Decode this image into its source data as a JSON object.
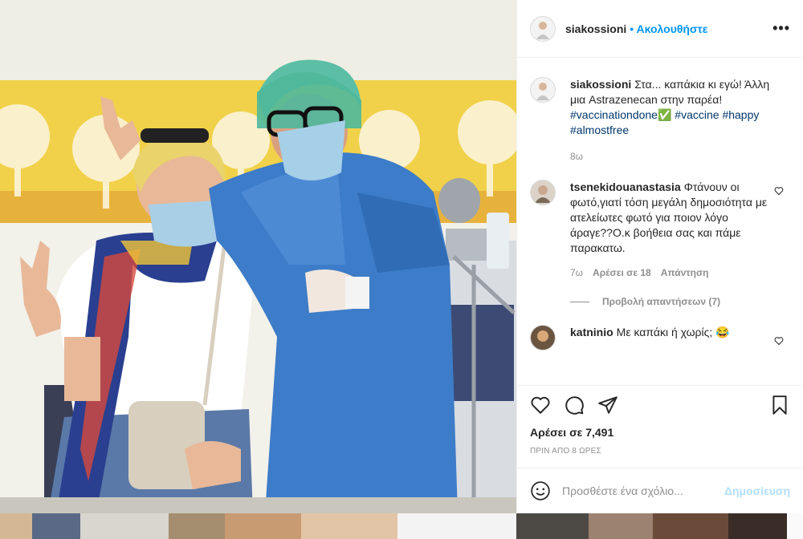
{
  "post": {
    "username": "siakossioni",
    "follow_label": "• Ακολουθήστε",
    "more_label": "•••",
    "caption": {
      "username": "siakossioni",
      "text": "Στα... καπάκια κι εγώ! Άλλη μια Astrazenecan στην παρέα!",
      "hashtags": [
        "#vaccinationdone✅",
        "#vaccine",
        "#happy",
        "#almostfree"
      ],
      "age": "8ω"
    },
    "comments": [
      {
        "username": "tsenekidouanastasia",
        "text": "Φτάνουν οι φωτό,γιατί τόση μεγάλη δημοσιότητα με ατελείωτες φωτό για ποιον λόγο άραγε??Ο.κ βοήθεια σας και πάμε παρακατω.",
        "age": "7ω",
        "likes": "Αρέσει σε 18",
        "reply": "Απάντηση",
        "view_replies": "Προβολή απαντήσεων (7)"
      },
      {
        "username": "katninio",
        "text": "Με καπάκι ή χωρίς; 😂"
      }
    ],
    "likes": "Αρέσει σε 7,491",
    "timestamp": "ΠΡΙΝ ΑΠΟ 8 ΩΡΕΣ",
    "comment_placeholder": "Προσθέστε ένα σχόλιο...",
    "publish_label": "Δημοσίευση"
  },
  "icons": {
    "heart": "heart-icon",
    "comment": "comment-icon",
    "share": "share-icon",
    "save": "bookmark-icon",
    "emoji": "emoji-icon"
  },
  "colors": {
    "accent": "#0095f6",
    "link": "#00376b",
    "muted": "#8e8e8e",
    "publish_disabled": "#b2dffc"
  }
}
